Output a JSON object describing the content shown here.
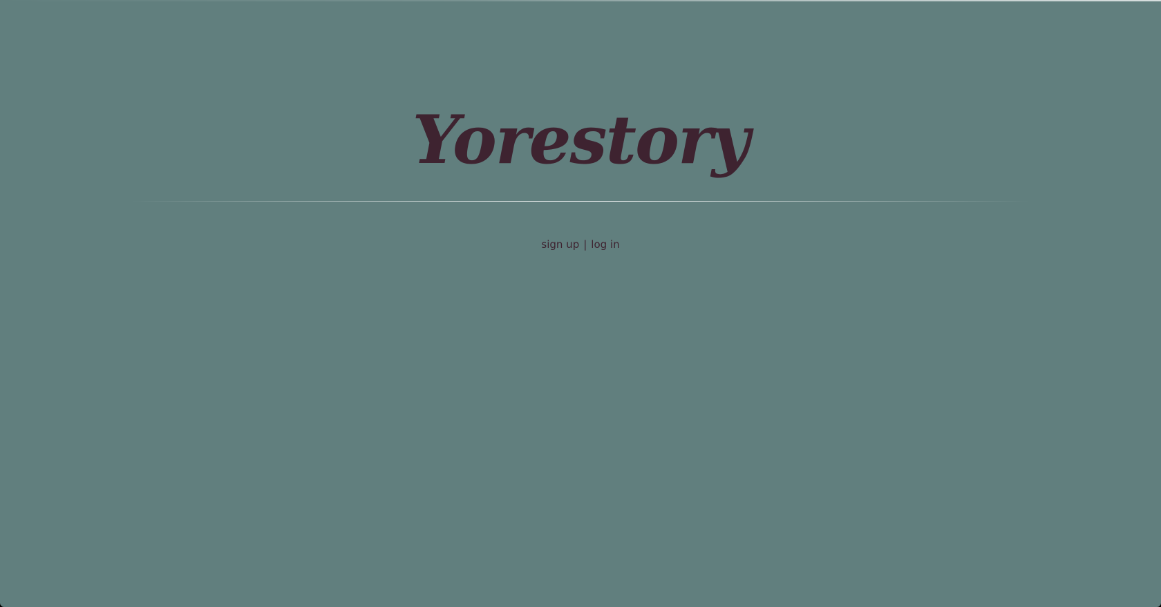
{
  "brand": {
    "logo_text": "Yorestory"
  },
  "auth": {
    "signup_label": "sign up",
    "separator": "|",
    "login_label": "log in"
  },
  "colors": {
    "background": "#617f7e",
    "accent": "#3e2330"
  }
}
